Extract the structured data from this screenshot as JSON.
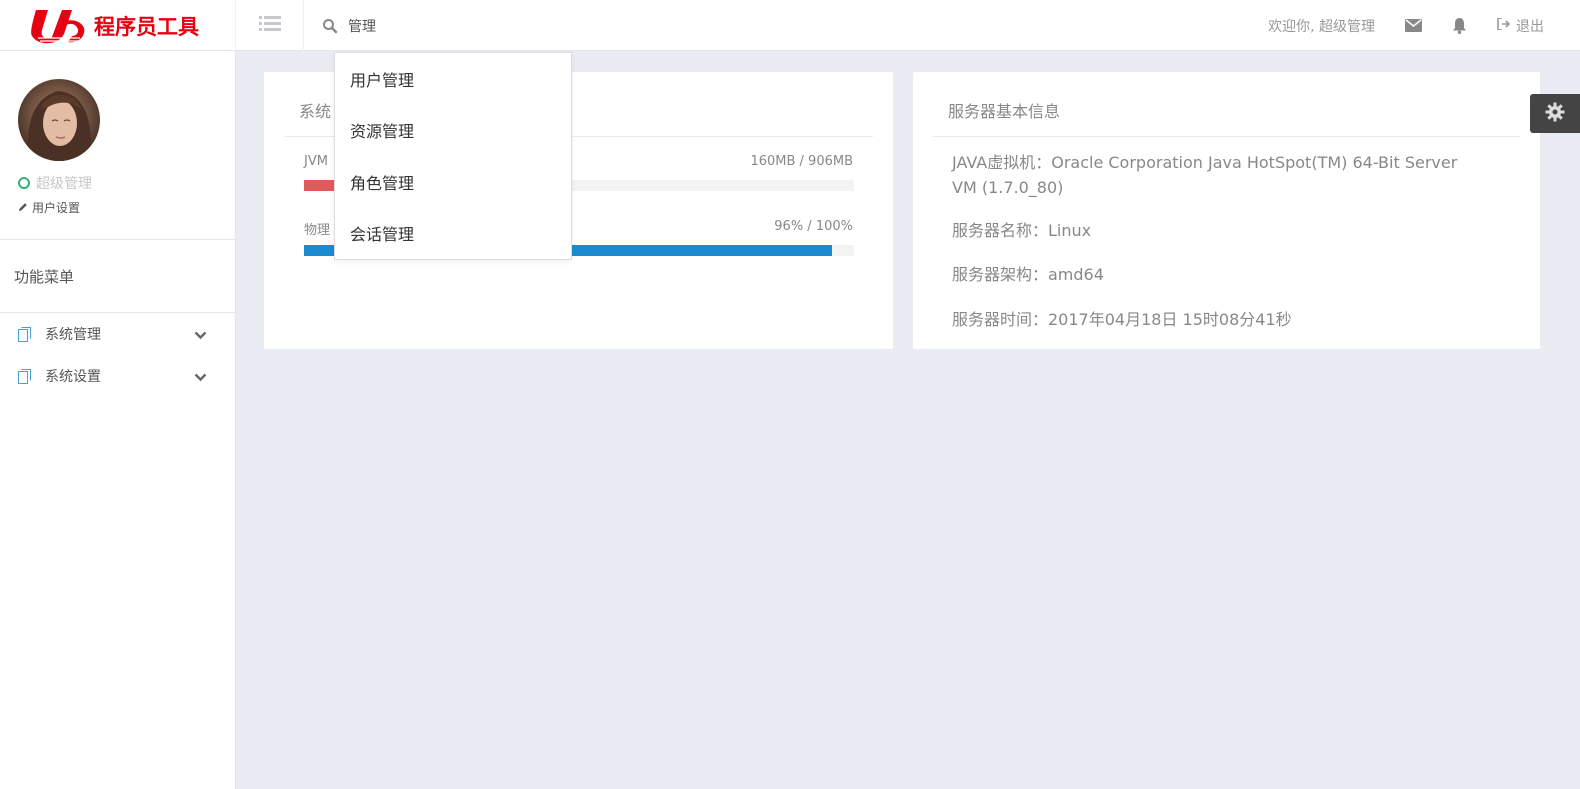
{
  "header": {
    "logo_text": "程序员工具",
    "search_value": "管理",
    "welcome": "欢迎你, 超级管理",
    "logout": "退出"
  },
  "search_dropdown": {
    "items": [
      "用户管理",
      "资源管理",
      "角色管理",
      "会话管理"
    ]
  },
  "sidebar": {
    "user_status": "超级管理",
    "user_settings": "用户设置",
    "menu_title": "功能菜单",
    "items": [
      {
        "label": "系统管理"
      },
      {
        "label": "系统设置"
      }
    ]
  },
  "system_panel": {
    "title": "系统",
    "bars": [
      {
        "label": "JVM",
        "value_text": "160MB / 906MB",
        "fraction": 0.1766,
        "color": "#e05b5b"
      },
      {
        "label": "物理",
        "value_text": "96% / 100%",
        "fraction": 0.96,
        "color": "#1a8bd0"
      }
    ]
  },
  "server_panel": {
    "title": "服务器基本信息",
    "lines": [
      "JAVA虚拟机：Oracle Corporation Java HotSpot(TM) 64-Bit Server VM (1.7.0_80)",
      "服务器名称：Linux",
      "服务器架构：amd64",
      "服务器时间：2017年04月18日 15时08分41秒"
    ]
  },
  "icons": {
    "menu_toggle": "list-icon",
    "search": "search-icon",
    "mail": "envelope-icon",
    "bell": "bell-icon",
    "logout": "logout-icon",
    "settings": "gear-icon"
  }
}
